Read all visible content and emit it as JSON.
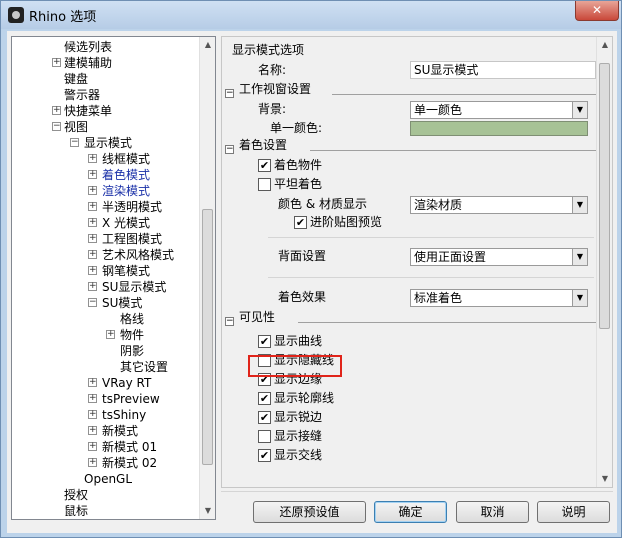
{
  "window": {
    "title": "Rhino 选项",
    "close_glyph": "✕"
  },
  "tree": {
    "items": [
      {
        "label": "候选列表",
        "indent": 0,
        "exp": "",
        "blue": false
      },
      {
        "label": "建模辅助",
        "indent": 0,
        "exp": "+",
        "blue": false
      },
      {
        "label": "键盘",
        "indent": 0,
        "exp": "",
        "blue": false
      },
      {
        "label": "警示器",
        "indent": 0,
        "exp": "",
        "blue": false
      },
      {
        "label": "快捷菜单",
        "indent": 0,
        "exp": "+",
        "blue": false
      },
      {
        "label": "视图",
        "indent": 0,
        "exp": "−",
        "blue": false
      },
      {
        "label": "显示模式",
        "indent": 1,
        "exp": "−",
        "blue": false
      },
      {
        "label": "线框模式",
        "indent": 2,
        "exp": "+",
        "blue": false
      },
      {
        "label": "着色模式",
        "indent": 2,
        "exp": "+",
        "blue": true
      },
      {
        "label": "渲染模式",
        "indent": 2,
        "exp": "+",
        "blue": true
      },
      {
        "label": "半透明模式",
        "indent": 2,
        "exp": "+",
        "blue": false
      },
      {
        "label": "X 光模式",
        "indent": 2,
        "exp": "+",
        "blue": false
      },
      {
        "label": "工程图模式",
        "indent": 2,
        "exp": "+",
        "blue": false
      },
      {
        "label": "艺术风格模式",
        "indent": 2,
        "exp": "+",
        "blue": false
      },
      {
        "label": "钢笔模式",
        "indent": 2,
        "exp": "+",
        "blue": false
      },
      {
        "label": "SU显示模式",
        "indent": 2,
        "exp": "+",
        "blue": false
      },
      {
        "label": "SU模式",
        "indent": 2,
        "exp": "−",
        "blue": false
      },
      {
        "label": "格线",
        "indent": 3,
        "exp": "",
        "blue": false
      },
      {
        "label": "物件",
        "indent": 3,
        "exp": "+",
        "blue": false
      },
      {
        "label": "阴影",
        "indent": 3,
        "exp": "",
        "blue": false
      },
      {
        "label": "其它设置",
        "indent": 3,
        "exp": "",
        "blue": false
      },
      {
        "label": "VRay RT",
        "indent": 2,
        "exp": "+",
        "blue": false
      },
      {
        "label": "tsPreview",
        "indent": 2,
        "exp": "+",
        "blue": false
      },
      {
        "label": "tsShiny",
        "indent": 2,
        "exp": "+",
        "blue": false
      },
      {
        "label": "新模式",
        "indent": 2,
        "exp": "+",
        "blue": false
      },
      {
        "label": "新模式 01",
        "indent": 2,
        "exp": "+",
        "blue": false
      },
      {
        "label": "新模式 02",
        "indent": 2,
        "exp": "+",
        "blue": false
      },
      {
        "label": "OpenGL",
        "indent": 1,
        "exp": "",
        "blue": false
      },
      {
        "label": "授权",
        "indent": 0,
        "exp": "",
        "blue": false
      },
      {
        "label": "鼠标",
        "indent": 0,
        "exp": "",
        "blue": false
      }
    ]
  },
  "options": {
    "header": "显示模式选项",
    "name_label": "名称:",
    "name_value": "SU显示模式",
    "viewport_section": "工作视窗设置",
    "background_label": "背景:",
    "background_value": "单一颜色",
    "solid_color_label": "单一颜色:",
    "solid_color": "#a7c296",
    "shading_section": "着色设置",
    "shade_objects": {
      "label": "着色物件",
      "checked": true
    },
    "flat_shading": {
      "label": "平坦着色",
      "checked": false
    },
    "color_material_label": "颜色 & 材质显示",
    "color_material_value": "渲染材质",
    "advanced_texture": {
      "label": "进阶贴图预览",
      "checked": true
    },
    "backface_label": "背面设置",
    "backface_value": "使用正面设置",
    "shading_effect_label": "着色效果",
    "shading_effect_value": "标准着色",
    "visibility_section": "可见性",
    "visibility_items": [
      {
        "label": "显示曲线",
        "checked": true
      },
      {
        "label": "显示隐藏线",
        "checked": false
      },
      {
        "label": "显示边缘",
        "checked": true
      },
      {
        "label": "显示轮廓线",
        "checked": true
      },
      {
        "label": "显示锐边",
        "checked": true
      },
      {
        "label": "显示接缝",
        "checked": false
      },
      {
        "label": "显示交线",
        "checked": true
      }
    ],
    "collapse_glyph": "−",
    "dropdown_glyph": "▼"
  },
  "buttons": {
    "restore_defaults": "还原预设值",
    "ok": "确定",
    "cancel": "取消",
    "help": "说明"
  },
  "highlight_color": "#e0241a"
}
